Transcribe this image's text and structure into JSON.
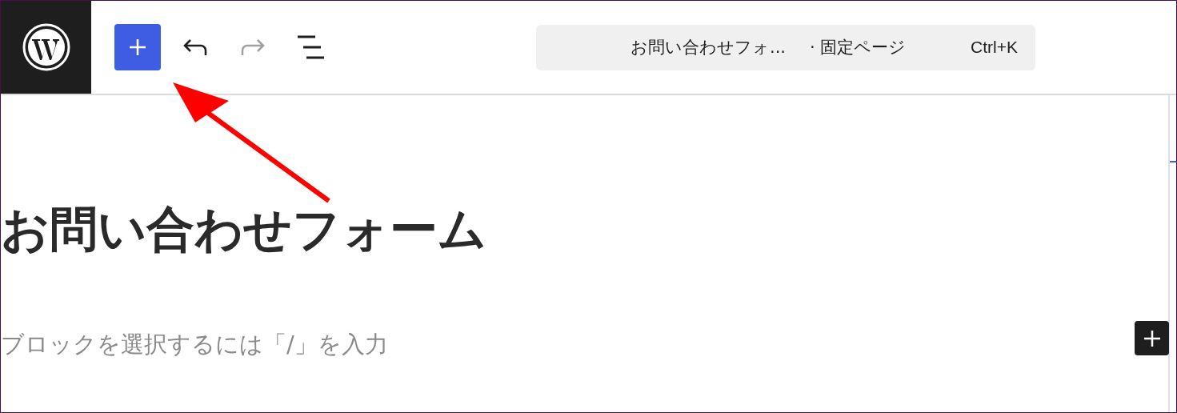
{
  "toolbar": {
    "buttons": [
      {
        "kind": "inserter",
        "selected": true,
        "disabled": false
      },
      {
        "kind": "undo",
        "selected": false,
        "disabled": false
      },
      {
        "kind": "redo",
        "selected": false,
        "disabled": true
      },
      {
        "kind": "list-view",
        "selected": false,
        "disabled": false
      }
    ]
  },
  "command_bar": {
    "title": "お問い合わせフォ...",
    "type": "· 固定ページ",
    "shortcut": "Ctrl+K"
  },
  "editor": {
    "title": "お問い合わせフォーム",
    "placeholder": "ブロックを選択するには「/」を入力"
  }
}
